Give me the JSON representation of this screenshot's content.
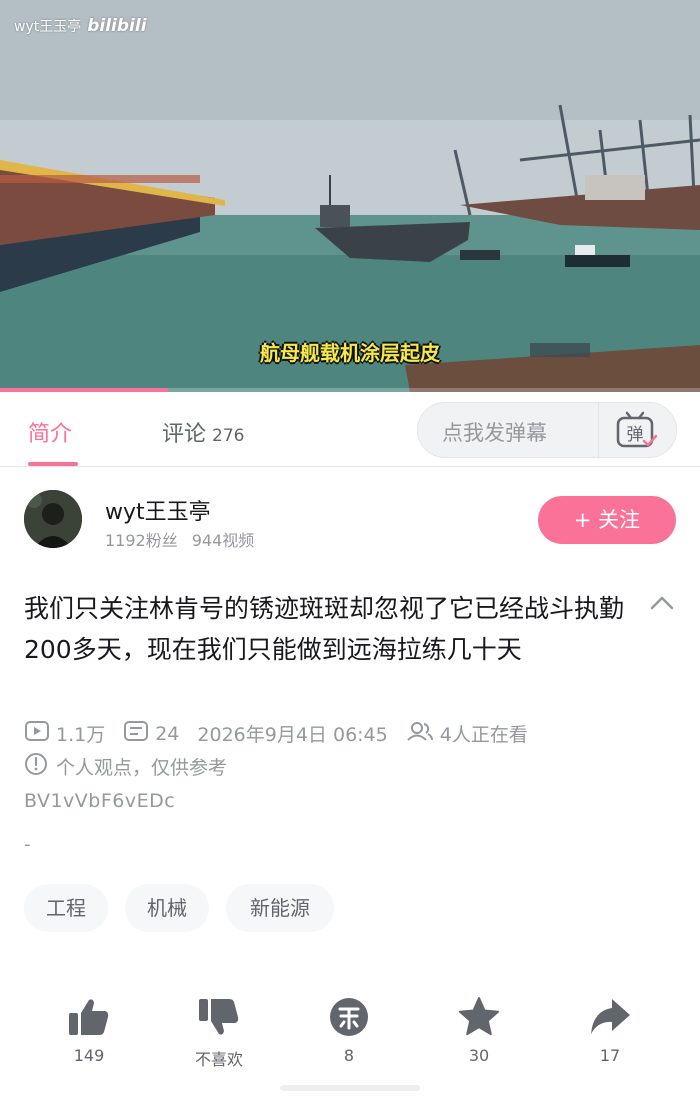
{
  "video": {
    "watermark_user": "wyt王玉亭",
    "watermark_brand": "bilibili",
    "subtitle": "航母舰载机涂层起皮",
    "progress_fraction": 0.24
  },
  "tabs": {
    "intro_label": "简介",
    "comments_label": "评论",
    "comments_count": "276",
    "danmaku_placeholder": "点我发弹幕",
    "danmaku_icon_text": "弹"
  },
  "uploader": {
    "name": "wyt王玉亭",
    "fans": "1192粉丝",
    "videos": "944视频",
    "follow_label": "+ 关注"
  },
  "video_info": {
    "title": "我们只关注林肯号的锈迹斑斑却忽视了它已经战斗执勤200多天，现在我们只能做到远海拉练几十天",
    "views": "1.1万",
    "danmaku_count": "24",
    "date": "2026年9月4日 06:45",
    "watching": "4人正在看",
    "notice": "个人观点，仅供参考",
    "bvid": "BV1vVbF6vEDc",
    "desc": "-"
  },
  "tags": [
    "工程",
    "机械",
    "新能源"
  ],
  "actions": {
    "like": "149",
    "dislike": "不喜欢",
    "coin": "8",
    "favorite": "30",
    "share": "17"
  },
  "colors": {
    "accent": "#fb7299",
    "text_primary": "#18191c",
    "text_secondary": "#9499a0"
  }
}
